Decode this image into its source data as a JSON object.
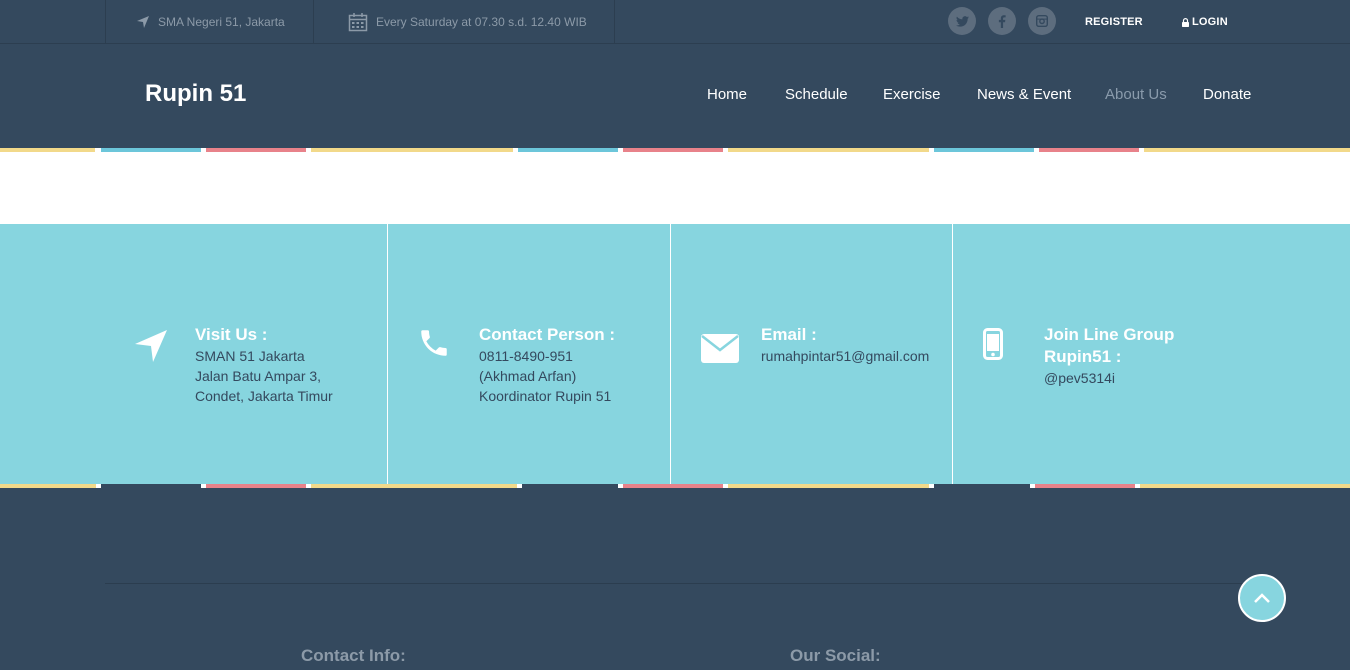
{
  "topbar": {
    "location": "SMA Negeri 51, Jakarta",
    "schedule": "Every Saturday at 07.30 s.d. 12.40 WIB",
    "register": "REGISTER",
    "login": "LOGIN"
  },
  "header": {
    "brand": "Rupin 51",
    "nav": [
      "Home",
      "Schedule",
      "Exercise",
      "News & Event",
      "About Us",
      "Donate"
    ],
    "active_nav": "About Us"
  },
  "contact": [
    {
      "icon": "location-arrow-icon",
      "title": "Visit Us :",
      "lines": [
        "SMAN 51 Jakarta",
        "Jalan Batu Ampar 3,",
        "Condet, Jakarta Timur"
      ]
    },
    {
      "icon": "phone-icon",
      "title": "Contact Person :",
      "lines": [
        "0811-8490-951",
        "(Akhmad Arfan)",
        "Koordinator Rupin 51"
      ]
    },
    {
      "icon": "envelope-icon",
      "title": "Email :",
      "lines": [
        "rumahpintar51@gmail.com"
      ]
    },
    {
      "icon": "mobile-phone-icon",
      "title_lines": [
        "Join Line Group",
        "Rupin51 :"
      ],
      "lines": [
        "@pev5314i"
      ]
    }
  ],
  "footer": {
    "contact_info": "Contact Info:",
    "our_social": "Our Social:"
  },
  "colors": {
    "navy": "#34495e",
    "teal": "#87d5df",
    "stripe_yellow": "#f2d98a",
    "stripe_blue": "#6cc6da",
    "stripe_red": "#e8828a",
    "nav_active": "#8a9bac"
  }
}
